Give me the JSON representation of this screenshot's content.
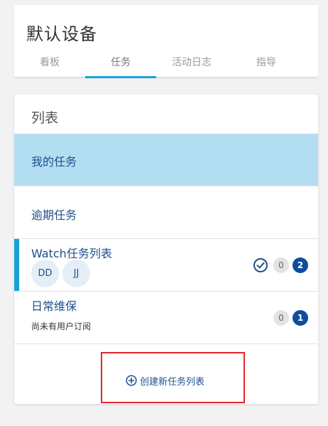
{
  "header": {
    "title": "默认设备",
    "tabs": [
      {
        "label": "看板"
      },
      {
        "label": "任务"
      },
      {
        "label": "活动日志"
      },
      {
        "label": "指导"
      }
    ],
    "active_tab": "任务"
  },
  "list_panel": {
    "title": "列表",
    "items": [
      {
        "label": "我的任务"
      },
      {
        "label": "逾期任务"
      },
      {
        "label": "Watch任务列表",
        "avatars": [
          "DD",
          "JJ"
        ],
        "icon": "check-circle-icon",
        "count_grey": "0",
        "count_blue": "2"
      },
      {
        "label": "日常维保",
        "subtext": "尚未有用户订阅",
        "count_grey": "0",
        "count_blue": "1"
      }
    ],
    "create_button": {
      "label": "创建新任务列表",
      "icon": "plus-circle-icon"
    }
  },
  "colors": {
    "accent": "#1aa0d8",
    "selected_row": "#b3def2",
    "link_text": "#1e4f8c",
    "badge_blue": "#0c4e9c",
    "annotation_box": "#e0262b"
  }
}
